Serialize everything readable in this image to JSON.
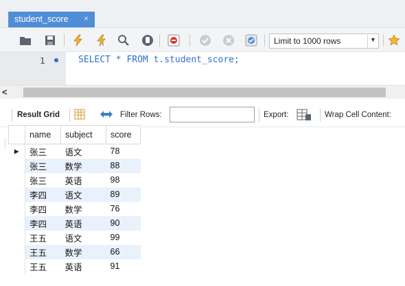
{
  "tab": {
    "title": "student_score",
    "close_glyph": "×"
  },
  "toolbar": {
    "icons": [
      "folder-open-icon",
      "save-icon",
      "execute-icon",
      "execute-current-icon",
      "explain-icon",
      "stop-icon",
      "toggle-continue-on-error-icon",
      "commit-icon",
      "rollback-icon",
      "autocommit-icon",
      "bookmark-star-icon"
    ],
    "limit_label": "Limit to 1000 rows"
  },
  "editor": {
    "line_number": "1",
    "sql": "SELECT * FROM t.student_score;"
  },
  "results": {
    "result_grid_label": "Result Grid",
    "filter_label": "Filter Rows:",
    "filter_value": "",
    "export_label": "Export:",
    "wrap_label": "Wrap Cell Content:"
  },
  "grid": {
    "columns": [
      "name",
      "subject",
      "score"
    ],
    "rows": [
      [
        "张三",
        "语文",
        "78"
      ],
      [
        "张三",
        "数学",
        "88"
      ],
      [
        "张三",
        "英语",
        "98"
      ],
      [
        "李四",
        "语文",
        "89"
      ],
      [
        "李四",
        "数学",
        "76"
      ],
      [
        "李四",
        "英语",
        "90"
      ],
      [
        "王五",
        "语文",
        "99"
      ],
      [
        "王五",
        "数学",
        "66"
      ],
      [
        "王五",
        "英语",
        "91"
      ]
    ]
  },
  "colors": {
    "tab_active": "#4f8ed7",
    "sql_keyword": "#2e73c8",
    "row_alt": "#e9f1fc"
  }
}
